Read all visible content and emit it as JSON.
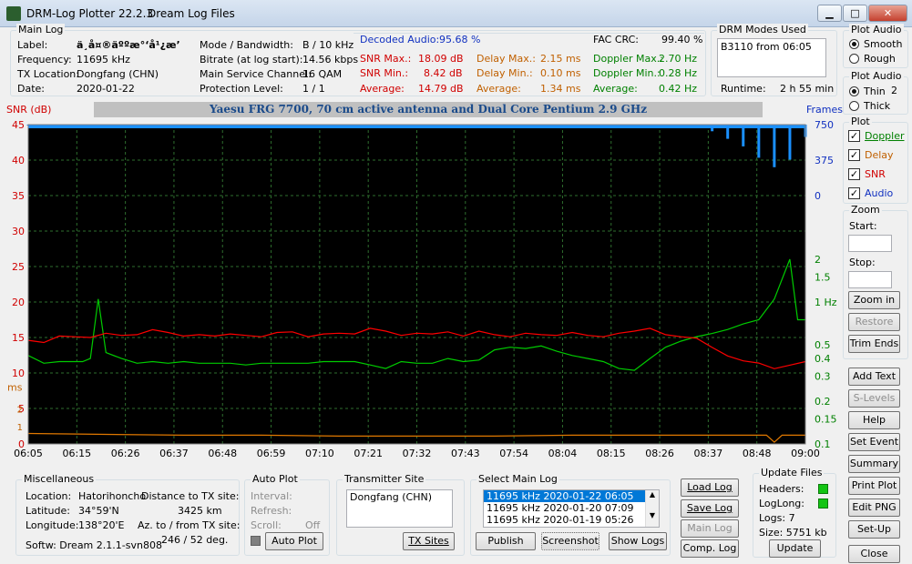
{
  "window": {
    "title": "DRM-Log Plotter 22.2.3",
    "subtitle": "Dream Log Files",
    "min": "▁",
    "max": "□",
    "close": "✕"
  },
  "main_log": {
    "title": "Main Log",
    "label_k": "Label:",
    "label_v": "ä¸­å¤®äººæ°‘å¹¿æ’",
    "freq_k": "Frequency:",
    "freq_v": "11695   kHz",
    "txloc_k": "TX Location:",
    "txloc_v": "Dongfang (CHN)",
    "date_k": "Date:",
    "date_v": "2020-01-22",
    "mode_k": "Mode / Bandwidth:",
    "mode_v": "B / 10 kHz",
    "bitrate_k": "Bitrate (at log start):",
    "bitrate_v": "14.56 kbps",
    "msc_k": "Main Service Channel:",
    "msc_v": "16  QAM",
    "prot_k": "Protection Level:",
    "prot_v": "1 / 1",
    "dec_audio_k": "Decoded Audio:",
    "dec_audio_v": "95.68 %",
    "fac_k": "FAC  CRC:",
    "fac_v": "99.40 %",
    "snr_max_k": "SNR Max.:",
    "snr_max_v": "18.09  dB",
    "snr_min_k": "SNR Min.:",
    "snr_min_v": "8.42  dB",
    "snr_avg_k": "Average:",
    "snr_avg_v": "14.79  dB",
    "delay_max_k": "Delay Max.:",
    "delay_max_v": "2.15    ms",
    "delay_min_k": "Delay Min.:",
    "delay_min_v": "0.10    ms",
    "delay_avg_k": "Average:",
    "delay_avg_v": "1.34    ms",
    "dop_max_k": "Doppler Max.:",
    "dop_max_v": "2.70 Hz",
    "dop_min_k": "Doppler Min.:",
    "dop_min_v": "0.28 Hz",
    "dop_avg_k": "Average:",
    "dop_avg_v": "0.42 Hz"
  },
  "drm_modes": {
    "title": "DRM Modes Used",
    "entry": "B3110 from 06:05",
    "runtime_k": "Runtime:",
    "runtime_v": "2 h 55 min"
  },
  "plot_audio1": {
    "title": "Plot Audio",
    "opt1": "Smooth",
    "opt2": "Rough",
    "selected": "Smooth"
  },
  "plot_audio2": {
    "title": "Plot Audio",
    "opt1": "Thin",
    "opt2": "Thick",
    "width_value": "2",
    "selected": "Thin"
  },
  "plot_group": {
    "title": "Plot",
    "items": [
      "Doppler",
      "Delay",
      "SNR",
      "Audio"
    ]
  },
  "zoom": {
    "title": "Zoom",
    "start": "Start:",
    "stop": "Stop:",
    "zoom_in": "Zoom in",
    "restore": "Restore",
    "trim": "Trim Ends"
  },
  "side_buttons": {
    "add_text": "Add Text",
    "s_levels": "S-Levels",
    "help": "Help",
    "set_event": "Set Event",
    "summary": "Summary",
    "print_plot": "Print Plot",
    "edit_png": "Edit PNG",
    "set_up": "Set-Up",
    "close": "Close"
  },
  "chart_data": {
    "type": "line",
    "title": "Yaesu FRG 7700, 70 cm active antenna and Dual Core Pentium 2.9 GHz",
    "ylabel_left": "SNR (dB)",
    "ylabel_left2": "ms",
    "ylabel_right": "Frames",
    "ylabel_right2": "Hz",
    "x_ticks": [
      "06:05",
      "06:15",
      "06:26",
      "06:37",
      "06:48",
      "06:59",
      "07:10",
      "07:21",
      "07:32",
      "07:43",
      "07:54",
      "08:04",
      "08:15",
      "08:26",
      "08:37",
      "08:48",
      "09:00"
    ],
    "snr_ticks": [
      "45",
      "40",
      "35",
      "30",
      "25",
      "20",
      "15",
      "10",
      "5",
      "0"
    ],
    "ms_ticks": [
      "2",
      "1"
    ],
    "frames_ticks": [
      "750",
      "375",
      "0"
    ],
    "hz_ticks": [
      "2",
      "1.5",
      "1 Hz",
      "0.5",
      "0.4",
      "0.3",
      "0.2",
      "0.15",
      "0.1"
    ],
    "ylim_snr": [
      0,
      45
    ],
    "ylim_frames": [
      0,
      750
    ],
    "colors": {
      "snr": "#ff0000",
      "doppler": "#00cc00",
      "delay": "#e07800",
      "audio": "#1a90ff",
      "grid": "#2e6e2e",
      "bg": "#000000"
    },
    "series": [
      {
        "name": "SNR",
        "unit": "dB",
        "x": [
          0,
          2,
          4,
          6,
          8,
          10,
          12,
          14,
          16,
          18,
          20,
          22,
          24,
          26,
          28,
          30,
          32,
          34,
          36,
          38,
          40,
          42,
          44,
          46,
          48,
          50,
          52,
          54,
          56,
          58,
          60,
          62,
          64,
          66,
          68,
          70,
          72,
          74,
          76,
          78,
          80,
          82,
          84,
          86,
          88,
          90,
          92,
          94,
          96,
          98,
          100
        ],
        "y": [
          14.6,
          14.3,
          15.2,
          15.1,
          15.0,
          15.6,
          15.3,
          15.4,
          16.1,
          15.7,
          15.2,
          15.4,
          15.2,
          15.5,
          15.3,
          15.1,
          15.7,
          15.8,
          15.1,
          15.5,
          15.6,
          15.5,
          16.3,
          15.9,
          15.3,
          15.6,
          15.5,
          15.8,
          15.2,
          15.9,
          15.4,
          15.1,
          15.6,
          15.4,
          15.3,
          15.7,
          15.3,
          15.1,
          15.6,
          15.9,
          16.3,
          15.4,
          15.1,
          14.9,
          13.6,
          12.4,
          11.7,
          11.4,
          10.6,
          11.1,
          11.6
        ]
      },
      {
        "name": "Doppler",
        "unit": "Hz",
        "x": [
          0,
          2,
          4,
          6,
          7,
          8,
          9,
          10,
          12,
          14,
          16,
          18,
          20,
          22,
          24,
          26,
          28,
          30,
          32,
          34,
          36,
          38,
          40,
          42,
          44,
          46,
          48,
          50,
          52,
          54,
          56,
          58,
          60,
          62,
          64,
          66,
          68,
          70,
          72,
          74,
          76,
          78,
          80,
          82,
          84,
          86,
          88,
          90,
          92,
          94,
          96,
          98,
          99,
          100
        ],
        "y": [
          0.42,
          0.37,
          0.38,
          0.38,
          0.38,
          0.4,
          1.05,
          0.44,
          0.4,
          0.37,
          0.38,
          0.37,
          0.38,
          0.37,
          0.37,
          0.37,
          0.36,
          0.37,
          0.37,
          0.37,
          0.37,
          0.38,
          0.38,
          0.38,
          0.36,
          0.34,
          0.38,
          0.37,
          0.37,
          0.4,
          0.38,
          0.39,
          0.46,
          0.48,
          0.47,
          0.49,
          0.45,
          0.42,
          0.4,
          0.38,
          0.34,
          0.33,
          0.4,
          0.48,
          0.53,
          0.57,
          0.6,
          0.64,
          0.7,
          0.75,
          1.05,
          2.0,
          0.75,
          0.75
        ]
      },
      {
        "name": "Delay",
        "unit": "ms",
        "x": [
          0,
          10,
          20,
          30,
          40,
          50,
          60,
          70,
          80,
          90,
          95,
          96,
          97,
          98,
          100
        ],
        "y": [
          0.6,
          0.55,
          0.5,
          0.5,
          0.45,
          0.45,
          0.45,
          0.5,
          0.5,
          0.5,
          0.5,
          0.1,
          0.5,
          0.5,
          0.5
        ]
      },
      {
        "name": "Audio",
        "unit": "frames",
        "x": [
          0,
          10,
          20,
          30,
          40,
          50,
          60,
          70,
          80,
          88,
          90,
          92,
          94,
          96,
          98,
          100
        ],
        "y": [
          740,
          740,
          738,
          740,
          739,
          740,
          740,
          740,
          740,
          680,
          600,
          520,
          400,
          300,
          380,
          620
        ]
      }
    ]
  },
  "misc": {
    "title": "Miscellaneous",
    "loc_k": "Location:",
    "loc_v": "Hatorihoncho",
    "dist_k": "Distance to TX site:",
    "dist_v": "3425    km",
    "lat_k": "Latitude:",
    "lat_v": "34°59'N",
    "lon_k": "Longitude:",
    "lon_v": "138°20'E",
    "az_k": "Az. to / from TX site:",
    "az_v": "246 / 52   deg.",
    "softw": "Softw:  Dream 2.1.1-svn808"
  },
  "auto_plot": {
    "title": "Auto Plot",
    "interval": "Interval:",
    "refresh": "Refresh:",
    "scroll": "Scroll:",
    "scroll_v": "Off",
    "button": "Auto Plot"
  },
  "tx_site": {
    "title": "Transmitter Site",
    "value": "Dongfang (CHN)",
    "button": "TX Sites"
  },
  "select_log": {
    "title": "Select Main Log",
    "rows": [
      "11695 kHz   2020-01-22    06:05",
      "11695 kHz   2020-01-20    07:09",
      "11695 kHz   2020-01-19    05:26"
    ],
    "publish": "Publish",
    "screenshot": "Screenshot",
    "show_logs": "Show Logs"
  },
  "log_buttons": {
    "load": "Load Log",
    "save": "Save Log",
    "main": "Main Log",
    "comp": "Comp. Log"
  },
  "update_files": {
    "title": "Update Files",
    "headers": "Headers:",
    "loglong": "LogLong:",
    "logs": "Logs:  7",
    "size": "Size:   5751 kb",
    "button": "Update"
  }
}
